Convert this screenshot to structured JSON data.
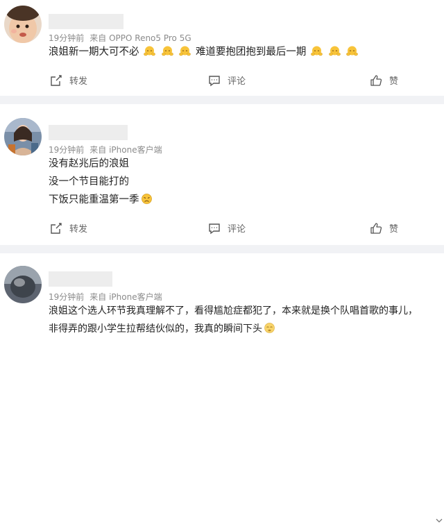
{
  "posts": [
    {
      "time": "19分钟前",
      "source": "来自 OPPO Reno5 Pro 5G",
      "text_a": "浪姐新一期大可不必",
      "text_b": "难道要抱团抱到最后一期",
      "repost_label": "转发",
      "comment_label": "评论",
      "like_label": "赞"
    },
    {
      "time": "19分钟前",
      "source": "来自 iPhone客户端",
      "line1": "没有赵兆后的浪姐",
      "line2": "没一个节目能打的",
      "line3": "下饭只能重温第一季",
      "repost_label": "转发",
      "comment_label": "评论",
      "like_label": "赞"
    },
    {
      "time": "19分钟前",
      "source": "来自 iPhone客户端",
      "line1": "浪姐这个选人环节我真理解不了，看得尴尬症都犯了，本来就是换个队唱首歌的事儿，",
      "line2": "非得弄的跟小学生拉帮结伙似的，我真的瞬间下头"
    }
  ],
  "icons": {
    "emoji_1": "hug-emoji-icon",
    "emoji_2": "sad-face-emoji-icon",
    "emoji_3": "speechless-face-emoji-icon",
    "repost": "repost-icon",
    "comment": "comment-icon",
    "like": "thumbs-up-icon",
    "expand": "chevron-down-icon"
  },
  "colors": {
    "meta_text": "#8b8b8b",
    "separator": "#f1f2f5",
    "emoji_yellow": "#f8c43a"
  }
}
